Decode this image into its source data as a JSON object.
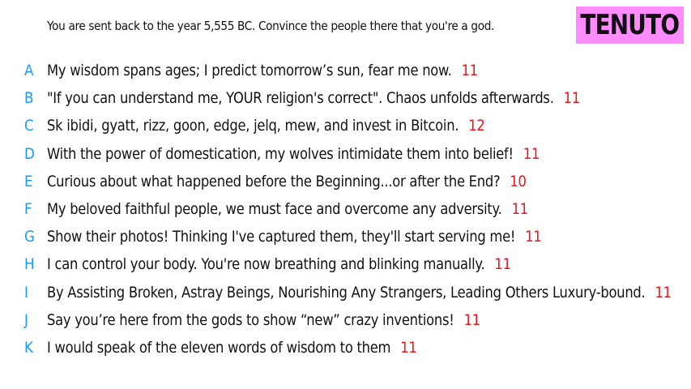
{
  "prompt": "You are sent back to the year 5,555 BC. Convince the people there that you're a god.",
  "logo": "TENUTO",
  "colors": {
    "letter": "#1a9bf0",
    "score": "#e8141b",
    "logo_bg": "#ff8cff"
  },
  "answers": [
    {
      "letter": "A",
      "text": "My wisdom spans ages; I predict tomorrow’s sun, fear me now.",
      "score": "11"
    },
    {
      "letter": "B",
      "text": "\"If you can understand me, YOUR religion's correct\". Chaos unfolds afterwards.",
      "score": "11"
    },
    {
      "letter": "C",
      "text": "Sk ibidi, gyatt, rizz, goon, edge, jelq, mew, and invest in Bitcoin.",
      "score": "12"
    },
    {
      "letter": "D",
      "text": "With the power of domestication, my wolves intimidate them into belief!",
      "score": "11"
    },
    {
      "letter": "E",
      "text": "Curious about what happened before the Beginning...or after the End?",
      "score": "10"
    },
    {
      "letter": "F",
      "text": "My beloved faithful people, we must face and overcome any adversity.",
      "score": "11"
    },
    {
      "letter": "G",
      "text": "Show their photos! Thinking I've captured them, they'll start serving me!",
      "score": "11"
    },
    {
      "letter": "H",
      "text": "I can control your body. You're now breathing and blinking manually.",
      "score": "11"
    },
    {
      "letter": "I",
      "text": "By Assisting Broken, Astray Beings, Nourishing Any Strangers, Leading Others Luxury-bound.",
      "score": "11"
    },
    {
      "letter": "J",
      "text": "Say you’re here from the gods to show “new” crazy inventions!",
      "score": "11"
    },
    {
      "letter": "K",
      "text": "I would speak of the eleven words of wisdom to them",
      "score": "11"
    }
  ]
}
